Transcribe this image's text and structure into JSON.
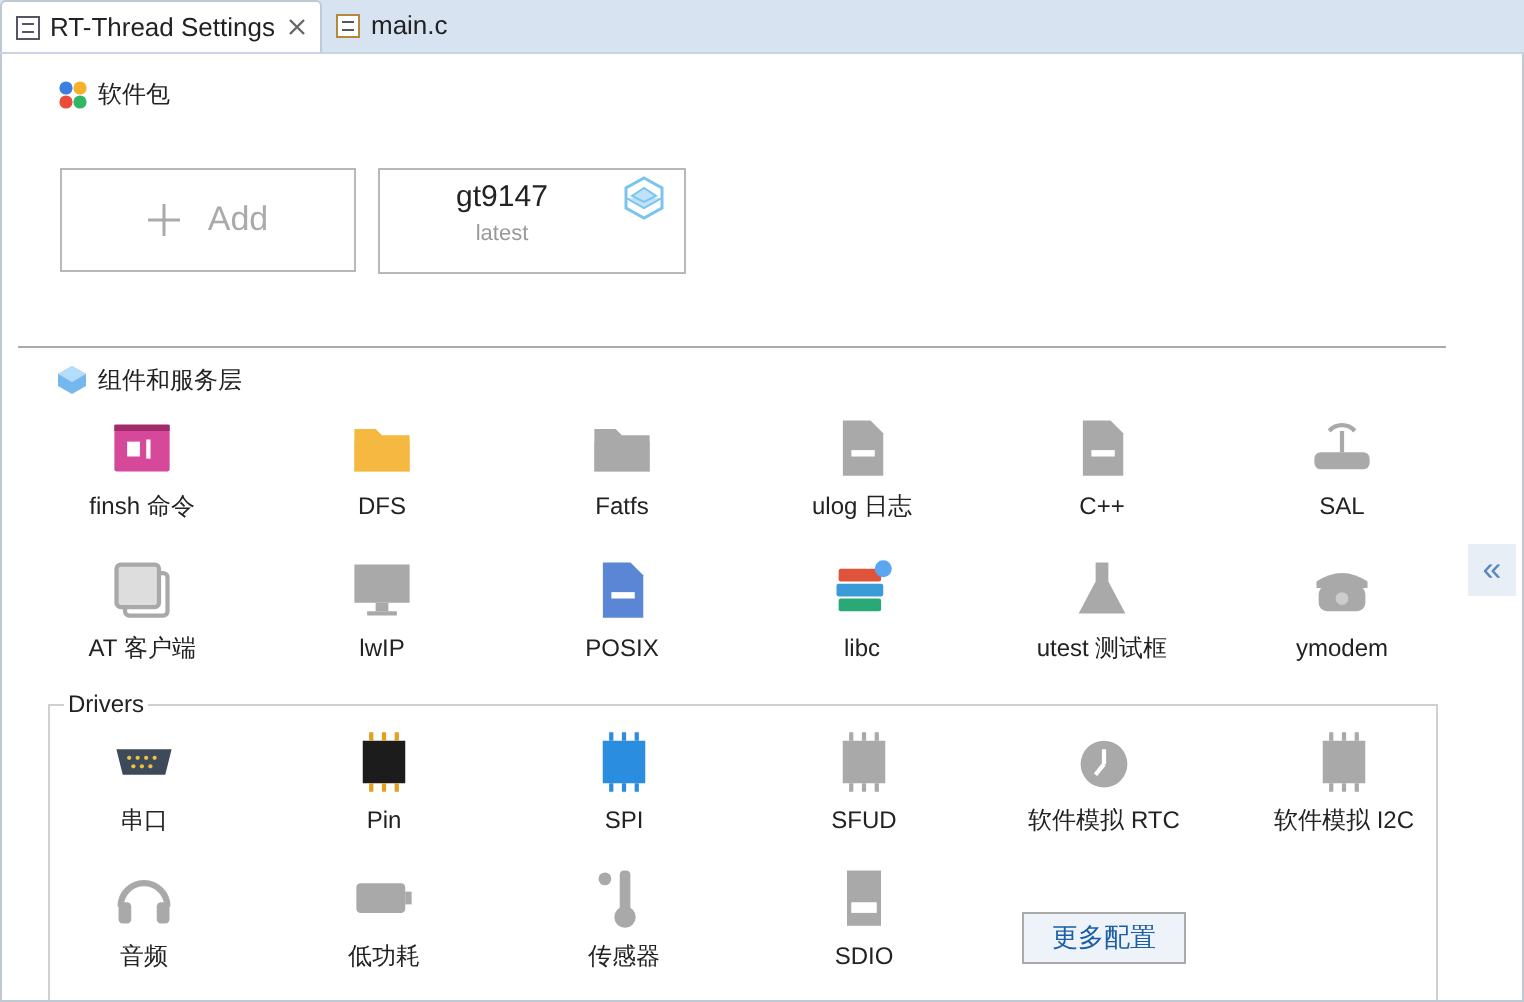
{
  "tabs": [
    {
      "label": "RT-Thread Settings",
      "selected": true,
      "closable": true
    },
    {
      "label": "main.c",
      "selected": false,
      "closable": false
    }
  ],
  "packages": {
    "title": "软件包",
    "add_label": "Add",
    "items": [
      {
        "name": "gt9147",
        "version": "latest"
      }
    ]
  },
  "components": {
    "title": "组件和服务层",
    "items": [
      {
        "label": "finsh 命令",
        "enabled": true
      },
      {
        "label": "DFS",
        "enabled": true
      },
      {
        "label": "Fatfs",
        "enabled": false
      },
      {
        "label": "ulog 日志",
        "enabled": false
      },
      {
        "label": "C++",
        "enabled": false
      },
      {
        "label": "SAL",
        "enabled": false
      },
      {
        "label": "AT 客户端",
        "enabled": false
      },
      {
        "label": "lwIP",
        "enabled": false
      },
      {
        "label": "POSIX",
        "enabled": true
      },
      {
        "label": "libc",
        "enabled": true
      },
      {
        "label": "utest 测试框",
        "enabled": false
      },
      {
        "label": "ymodem",
        "enabled": false
      }
    ]
  },
  "drivers": {
    "title": "Drivers",
    "items": [
      {
        "label": "串口",
        "enabled": true
      },
      {
        "label": "Pin",
        "enabled": true
      },
      {
        "label": "SPI",
        "enabled": true
      },
      {
        "label": "SFUD",
        "enabled": false
      },
      {
        "label": "软件模拟 RTC",
        "enabled": false
      },
      {
        "label": "软件模拟 I2C",
        "enabled": false
      },
      {
        "label": "音频",
        "enabled": false
      },
      {
        "label": "低功耗",
        "enabled": false
      },
      {
        "label": "传感器",
        "enabled": false
      },
      {
        "label": "SDIO",
        "enabled": false
      }
    ],
    "more_button": "更多配置"
  },
  "collapse_button": "«"
}
